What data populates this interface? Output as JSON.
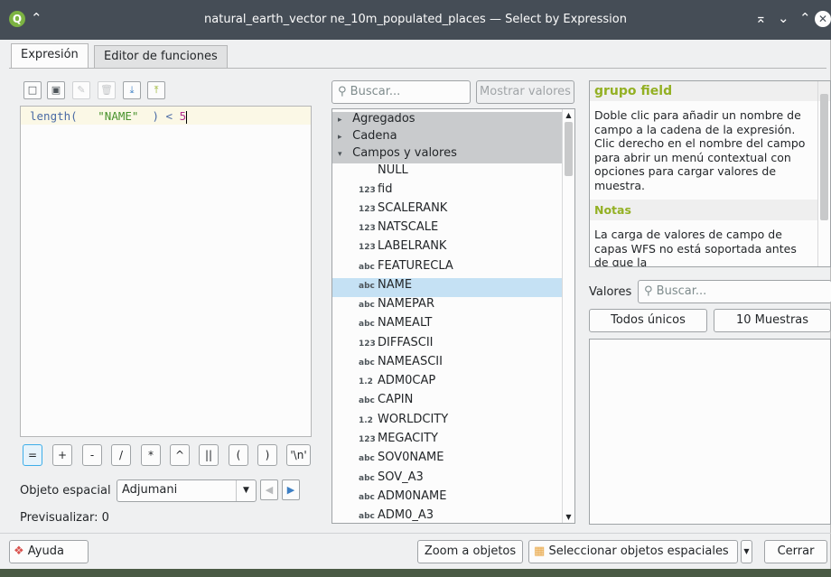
{
  "window": {
    "title": "natural_earth_vector ne_10m_populated_places — Select by Expression",
    "title_buttons": [
      "⌅",
      "⌄",
      "⌃",
      "✕"
    ]
  },
  "tabs": [
    {
      "label": "Expresión",
      "active": true
    },
    {
      "label": "Editor de funciones",
      "active": false
    }
  ],
  "toolbar_icons": [
    "new-file-icon",
    "save-icon",
    "edit-icon",
    "delete-icon",
    "import-icon",
    "export-icon"
  ],
  "editor": {
    "func": "length(",
    "field": "\"NAME\"",
    "op": ") <",
    "num": "5"
  },
  "operators": [
    "=",
    "+",
    "-",
    "/",
    "*",
    "^",
    "||",
    "(",
    ")",
    "'\\n'"
  ],
  "spatial": {
    "label": "Objeto espacial",
    "value": "Adjumani"
  },
  "preview": {
    "label": "Previsualizar:",
    "value": "0"
  },
  "search": {
    "placeholder": "Buscar...",
    "show_values_label": "Mostrar valores"
  },
  "tree": {
    "groups": [
      {
        "label": "Agregados",
        "expanded": false
      },
      {
        "label": "Cadena",
        "expanded": false
      },
      {
        "label": "Campos y valores",
        "expanded": true
      }
    ],
    "fields": [
      {
        "type": "",
        "name": "NULL"
      },
      {
        "type": "123",
        "name": "fid"
      },
      {
        "type": "123",
        "name": "SCALERANK"
      },
      {
        "type": "123",
        "name": "NATSCALE"
      },
      {
        "type": "123",
        "name": "LABELRANK"
      },
      {
        "type": "abc",
        "name": "FEATURECLA"
      },
      {
        "type": "abc",
        "name": "NAME",
        "selected": true
      },
      {
        "type": "abc",
        "name": "NAMEPAR"
      },
      {
        "type": "abc",
        "name": "NAMEALT"
      },
      {
        "type": "123",
        "name": "DIFFASCII"
      },
      {
        "type": "abc",
        "name": "NAMEASCII"
      },
      {
        "type": "1.2",
        "name": "ADM0CAP"
      },
      {
        "type": "abc",
        "name": "CAPIN"
      },
      {
        "type": "1.2",
        "name": "WORLDCITY"
      },
      {
        "type": "123",
        "name": "MEGACITY"
      },
      {
        "type": "abc",
        "name": "SOV0NAME"
      },
      {
        "type": "abc",
        "name": "SOV_A3"
      },
      {
        "type": "abc",
        "name": "ADM0NAME"
      },
      {
        "type": "abc",
        "name": "ADM0_A3"
      }
    ]
  },
  "help": {
    "title": "grupo field",
    "body": "Doble clic para añadir un nombre de campo a la cadena de la expresión. Clic derecho en el nombre del campo para abrir un menú contextual con opciones para cargar valores de muestra.",
    "notes_title": "Notas",
    "notes_body": "La carga de valores de campo de capas WFS no está soportada antes de que la"
  },
  "values": {
    "label": "Valores",
    "search_placeholder": "Buscar...",
    "all_unique_label": "Todos únicos",
    "samples_label": "10 Muestras"
  },
  "footer": {
    "help_label": "Ayuda",
    "zoom_label": "Zoom a objetos",
    "select_label": "Seleccionar objetos espaciales",
    "close_label": "Cerrar"
  }
}
